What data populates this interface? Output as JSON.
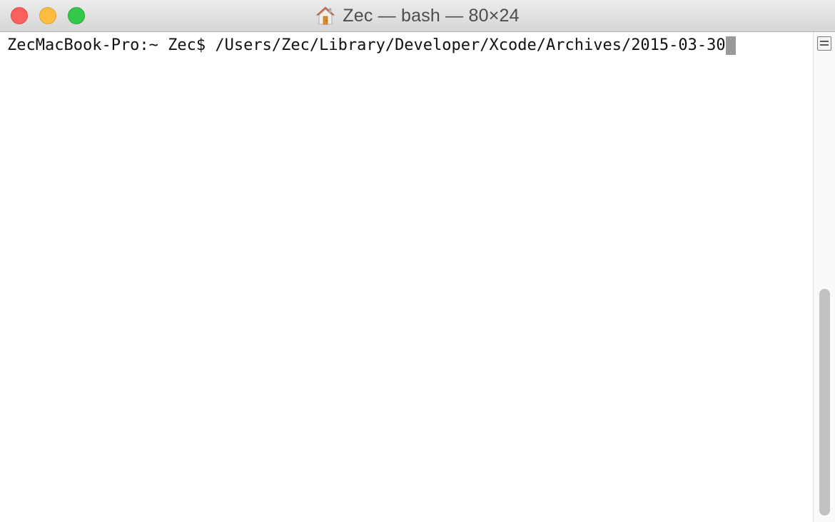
{
  "window": {
    "title": "Zec — bash — 80×24",
    "title_icon": "home-icon"
  },
  "terminal": {
    "prompt": "ZecMacBook-Pro:~ Zec$ ",
    "command": "/Users/Zec/Library/Developer/Xcode/Archives/2015-03-30"
  },
  "scrollbar": {
    "split_icon": "split-pane-icon"
  },
  "colors": {
    "close": "#fc605c",
    "minimize": "#fdbc40",
    "zoom": "#34c84a",
    "cursor": "#9a9a9a"
  }
}
